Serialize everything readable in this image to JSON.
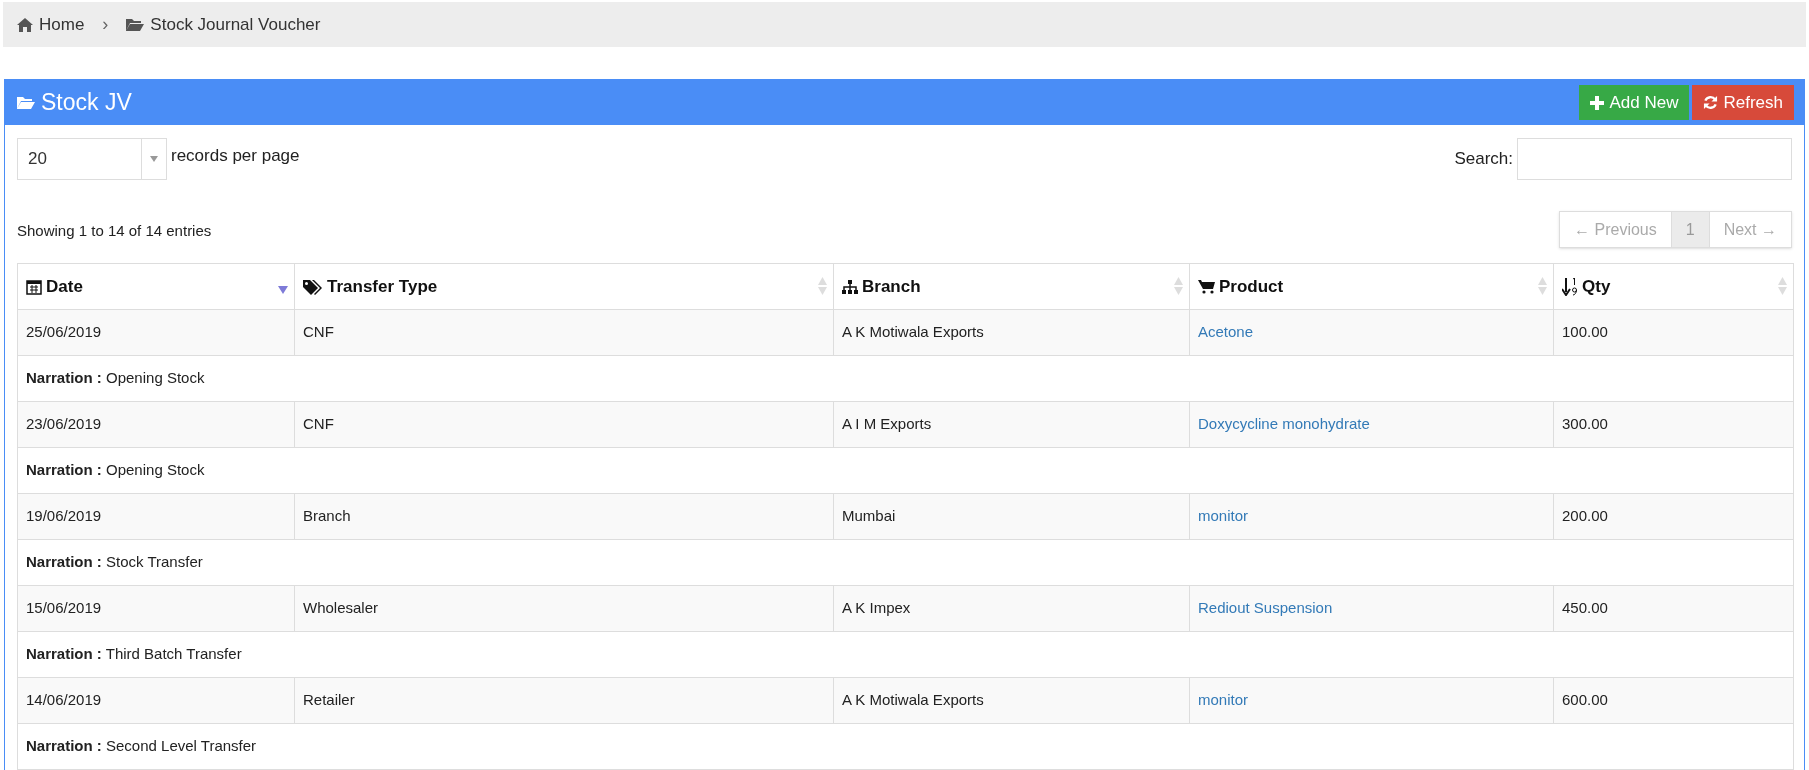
{
  "breadcrumb": [
    {
      "label": "Home"
    },
    {
      "label": "Stock Journal Voucher"
    }
  ],
  "breadcrumb_separator": "›",
  "panel": {
    "title": "Stock JV",
    "buttons": [
      {
        "label": "Add New",
        "kind": "add"
      },
      {
        "label": "Refresh",
        "kind": "refresh"
      }
    ]
  },
  "length_select": {
    "value": "20",
    "label": "records per page"
  },
  "search": {
    "label": "Search:"
  },
  "info": "Showing 1 to 14 of 14 entries",
  "pagination": [
    {
      "label": "← Previous",
      "selected": false,
      "disabled": true
    },
    {
      "label": "1",
      "selected": true,
      "disabled": false
    },
    {
      "label": "Next →",
      "selected": false,
      "disabled": true
    }
  ],
  "table": {
    "columns": [
      {
        "label": "Date",
        "sorted": true
      },
      {
        "label": "Transfer Type",
        "sorted": false
      },
      {
        "label": "Branch",
        "sorted": false
      },
      {
        "label": "Product",
        "sorted": false
      },
      {
        "label": "Qty",
        "sorted": false
      }
    ],
    "rows": [
      {
        "kind": "entry",
        "cells": [
          "25/06/2019",
          "CNF",
          "A K Motiwala Exports",
          "Acetone",
          "100.00"
        ]
      },
      {
        "kind": "narration",
        "label": "Narration :",
        "text": "Opening Stock"
      },
      {
        "kind": "entry",
        "cells": [
          "23/06/2019",
          "CNF",
          "A I M Exports",
          "Doxycycline monohydrate",
          "300.00"
        ]
      },
      {
        "kind": "narration",
        "label": "Narration :",
        "text": "Opening Stock"
      },
      {
        "kind": "entry",
        "cells": [
          "19/06/2019",
          "Branch",
          "Mumbai",
          "monitor",
          "200.00"
        ]
      },
      {
        "kind": "narration",
        "label": "Narration :",
        "text": "Stock Transfer"
      },
      {
        "kind": "entry",
        "cells": [
          "15/06/2019",
          "Wholesaler",
          "A K Impex",
          "Rediout Suspension",
          "450.00"
        ]
      },
      {
        "kind": "narration",
        "label": "Narration :",
        "text": "Third Batch Transfer"
      },
      {
        "kind": "entry",
        "cells": [
          "14/06/2019",
          "Retailer",
          "A K Motiwala Exports",
          "monitor",
          "600.00"
        ]
      },
      {
        "kind": "narration",
        "label": "Narration :",
        "text": "Second Level Transfer"
      }
    ]
  }
}
